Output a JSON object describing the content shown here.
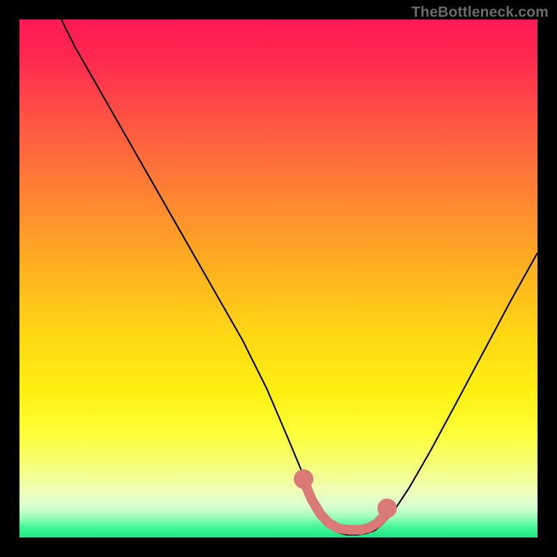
{
  "attribution": "TheBottleneck.com",
  "chart_data": {
    "type": "line",
    "title": "",
    "xlabel": "",
    "ylabel": "",
    "xlim": [
      0,
      100
    ],
    "ylim": [
      0,
      100
    ],
    "series": [
      {
        "name": "bottleneck-curve",
        "x": [
          0,
          5,
          10,
          15,
          20,
          25,
          30,
          35,
          40,
          45,
          50,
          52,
          54,
          56,
          58,
          60,
          62,
          64,
          66,
          70,
          75,
          80,
          85,
          90,
          95,
          100
        ],
        "y": [
          100,
          92,
          84,
          76,
          68,
          60,
          52,
          44,
          35,
          26,
          16,
          11,
          6,
          3,
          2,
          2,
          2,
          2,
          3,
          7,
          14,
          22,
          31,
          40,
          49,
          58
        ]
      },
      {
        "name": "highlight-band",
        "x": [
          52,
          54,
          56,
          58,
          60,
          62,
          64,
          66,
          68
        ],
        "y": [
          10,
          6,
          4,
          3,
          3,
          3,
          3,
          4,
          7
        ]
      }
    ],
    "highlight_color": "#d97a77",
    "curve_color": "#000000"
  }
}
